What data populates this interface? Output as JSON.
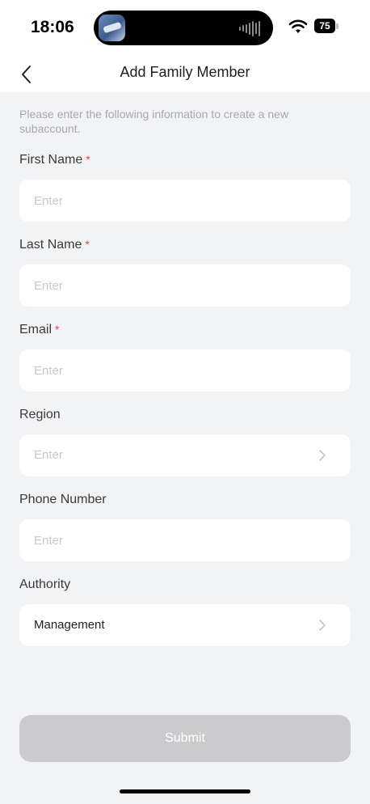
{
  "status_bar": {
    "time": "18:06",
    "battery": "75",
    "icons": [
      "wifi-icon",
      "battery-icon",
      "audio-wave-icon",
      "app-thumbnail-icon"
    ]
  },
  "nav": {
    "title": "Add Family Member",
    "back_icon": "chevron-left-icon"
  },
  "intro_text": "Please enter the following information to create a new subaccount.",
  "form": {
    "required_mark": "*",
    "first_name": {
      "label": "First Name",
      "placeholder": "Enter",
      "required": true
    },
    "last_name": {
      "label": "Last Name",
      "placeholder": "Enter",
      "required": true
    },
    "email": {
      "label": "Email",
      "placeholder": "Enter",
      "required": true
    },
    "region": {
      "label": "Region",
      "placeholder": "Enter",
      "required": false,
      "icon": "chevron-right-icon"
    },
    "phone": {
      "label": "Phone Number",
      "placeholder": "Enter",
      "required": false
    },
    "authority": {
      "label": "Authority",
      "value": "Management",
      "required": false,
      "icon": "chevron-right-icon"
    }
  },
  "submit_label": "Submit",
  "colors": {
    "background": "#f2f3f5",
    "required": "#e5484d",
    "submit_disabled": "#cbcbcd",
    "placeholder": "#c8c8cc"
  }
}
